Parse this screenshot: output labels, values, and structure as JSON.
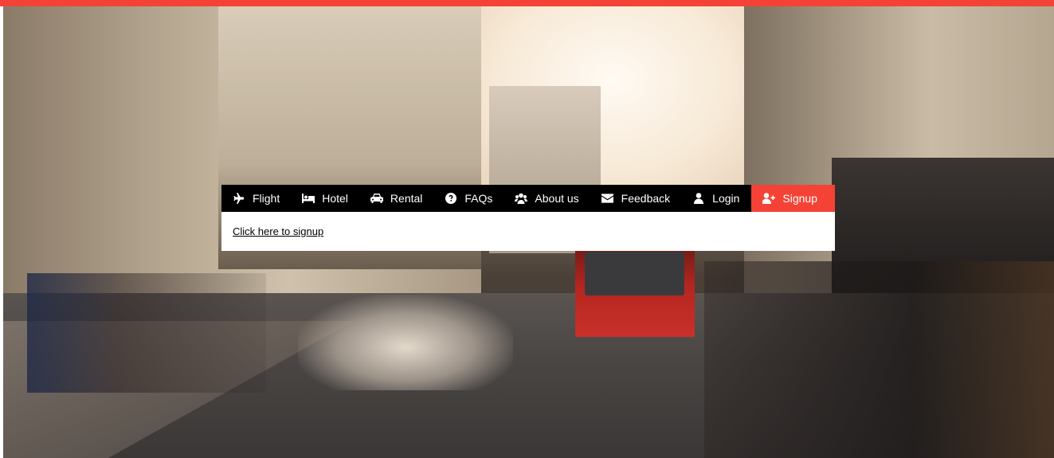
{
  "accent_color": "#f44336",
  "nav": {
    "items": [
      {
        "label": "Flight",
        "icon": "plane-icon"
      },
      {
        "label": "Hotel",
        "icon": "bed-icon"
      },
      {
        "label": "Rental",
        "icon": "car-icon"
      },
      {
        "label": "FAQs",
        "icon": "question-circle-icon"
      },
      {
        "label": "About us",
        "icon": "users-icon"
      },
      {
        "label": "Feedback",
        "icon": "envelope-icon"
      },
      {
        "label": "Login",
        "icon": "user-icon"
      },
      {
        "label": "Signup",
        "icon": "user-plus-icon",
        "active": true
      }
    ]
  },
  "panel": {
    "link_text": "Click here to signup"
  }
}
